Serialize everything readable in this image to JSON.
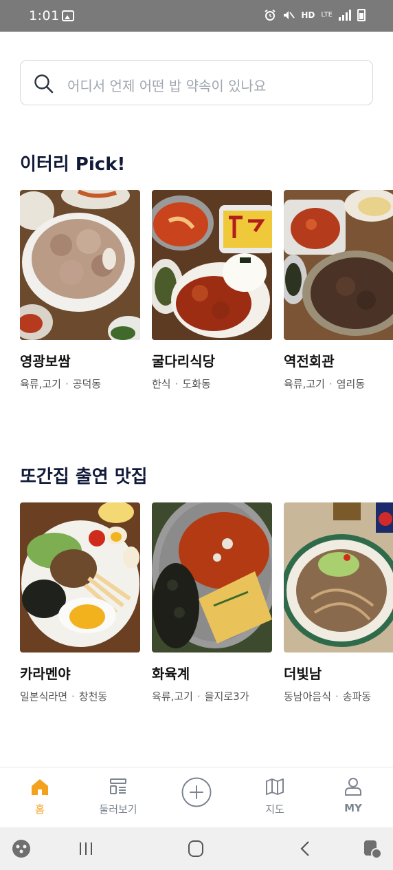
{
  "status_bar": {
    "time": "1:01",
    "icons": [
      "gallery-icon",
      "alarm-icon",
      "mute-icon",
      "hd-voice-icon",
      "lte-icon",
      "signal-icon",
      "battery-icon"
    ],
    "hd_label": "HD",
    "lte_label": "LTE"
  },
  "search": {
    "placeholder": "어디서 언제 어떤 밥 약속이 있나요"
  },
  "sections": [
    {
      "title": "이터리 Pick!",
      "cards": [
        {
          "name": "영광보쌈",
          "category": "육류,고기",
          "area": "공덕동"
        },
        {
          "name": "굴다리식당",
          "category": "한식",
          "area": "도화동"
        },
        {
          "name": "역전회관",
          "category": "육류,고기",
          "area": "염리동"
        }
      ]
    },
    {
      "title": "또간집 출연 맛집",
      "cards": [
        {
          "name": "카라멘야",
          "category": "일본식라면",
          "area": "창천동"
        },
        {
          "name": "화육계",
          "category": "육류,고기",
          "area": "을지로3가"
        },
        {
          "name": "더빛남",
          "category": "동남아음식",
          "area": "송파동"
        }
      ]
    }
  ],
  "bottom_nav": [
    {
      "label": "홈",
      "icon": "home-icon",
      "active": true
    },
    {
      "label": "둘러보기",
      "icon": "browse-icon",
      "active": false
    },
    {
      "label": "",
      "icon": "plus-circle-icon",
      "active": false
    },
    {
      "label": "지도",
      "icon": "map-icon",
      "active": false
    },
    {
      "label": "MY",
      "icon": "user-icon",
      "active": false
    }
  ],
  "system_nav": [
    "game-launcher-icon",
    "recent-apps-icon",
    "home-button-icon",
    "back-icon",
    "assistant-icon"
  ],
  "colors": {
    "accent": "#f4a11d",
    "title": "#121a3a",
    "muted": "#7c8490",
    "status_bar": "#7a7a7a"
  },
  "separator": "·"
}
